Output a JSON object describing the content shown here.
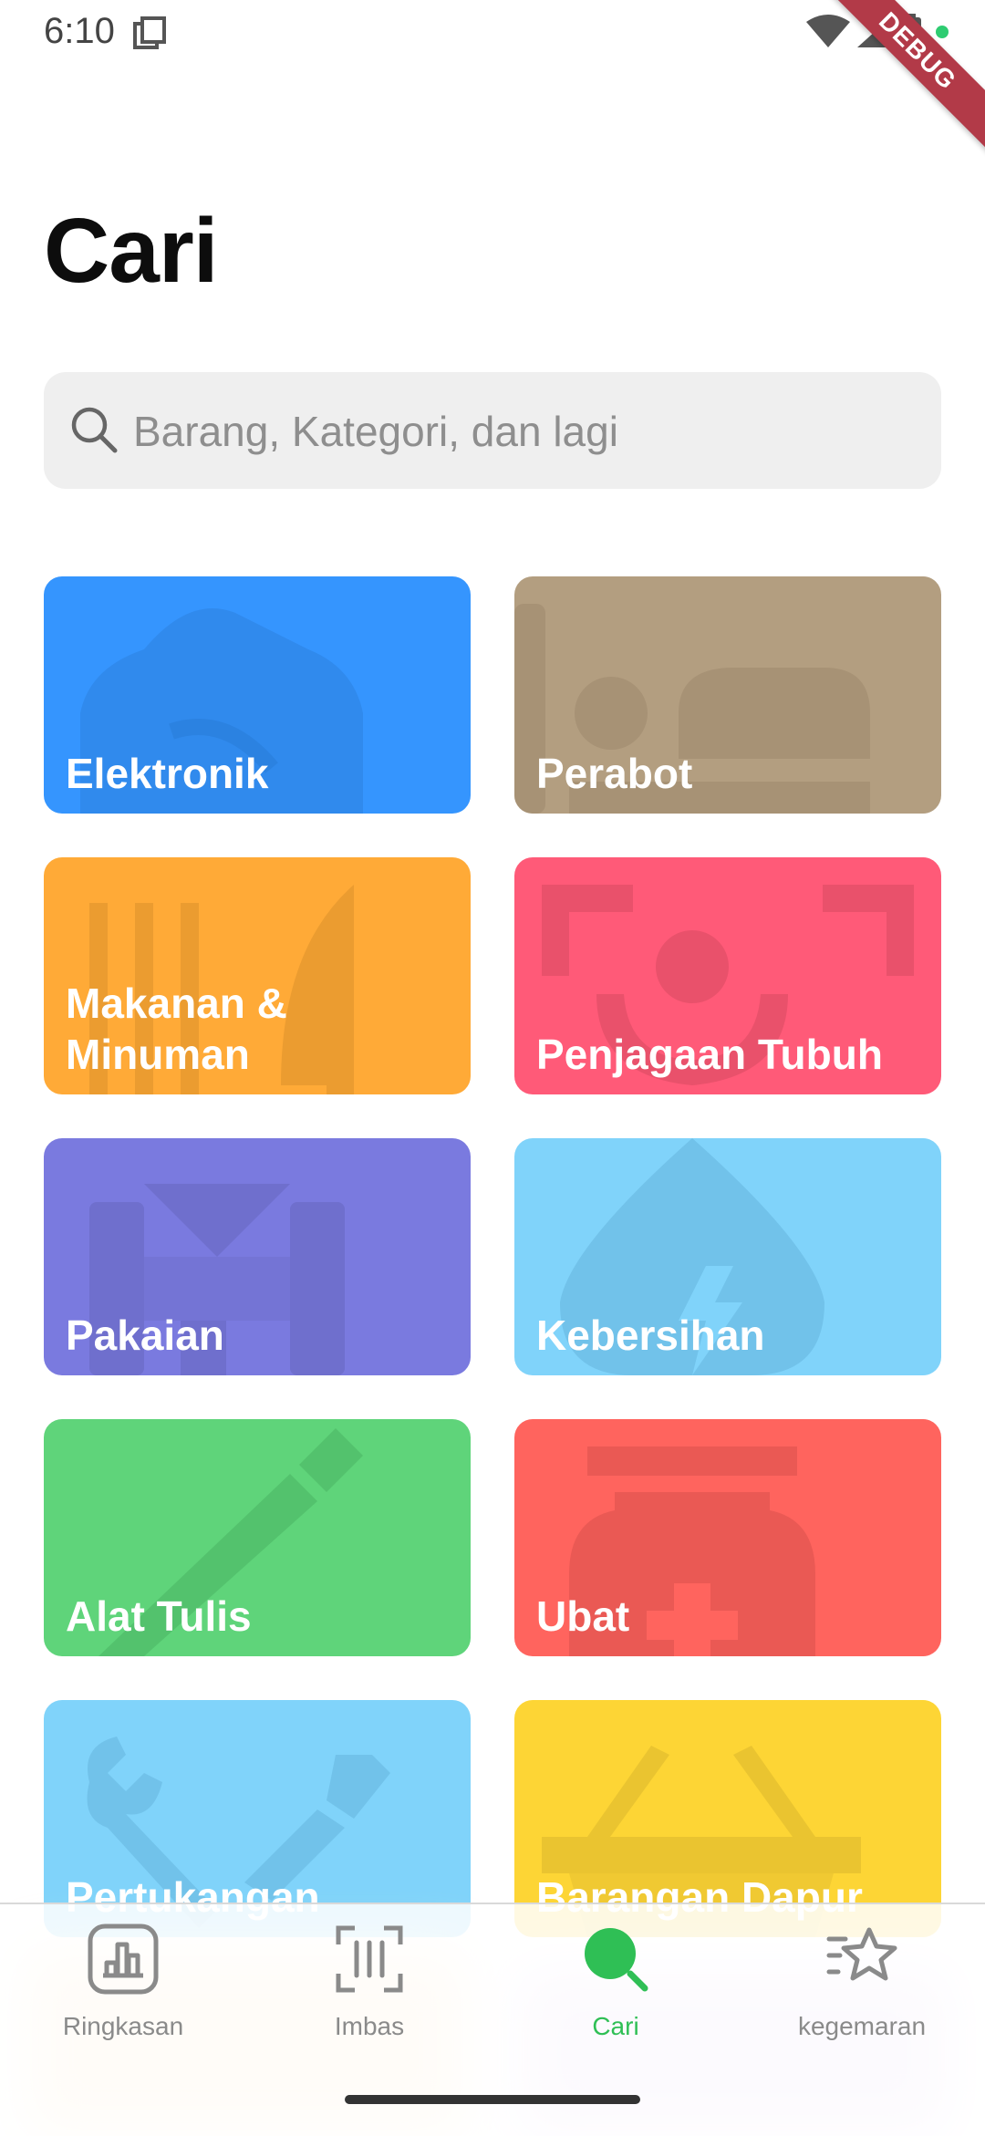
{
  "status_bar": {
    "time": "6:10",
    "debug_label": "DEBUG"
  },
  "page": {
    "title": "Cari"
  },
  "search": {
    "placeholder": "Barang, Kategori, dan lagi"
  },
  "categories": [
    {
      "label": "Elektronik",
      "color": "#3595FE",
      "icon": "router-icon"
    },
    {
      "label": "Perabot",
      "color": "#B39E80",
      "icon": "bed-icon"
    },
    {
      "label": "Makanan & Minuman",
      "color": "#FFAA37",
      "icon": "utensils-icon"
    },
    {
      "label": "Penjagaan Tubuh",
      "color": "#FF5A78",
      "icon": "face-scan-icon"
    },
    {
      "label": "Pakaian",
      "color": "#7A7ADF",
      "icon": "suit-icon"
    },
    {
      "label": "Kebersihan",
      "color": "#80D3FA",
      "icon": "water-drop-icon"
    },
    {
      "label": "Alat Tulis",
      "color": "#5FD47A",
      "icon": "pen-icon"
    },
    {
      "label": "Ubat",
      "color": "#FF645E",
      "icon": "medicine-bottle-icon"
    },
    {
      "label": "Pertukangan",
      "color": "#80D3FA",
      "icon": "tools-icon"
    },
    {
      "label": "Barangan Dapur",
      "color": "#FDD535",
      "icon": "basket-icon"
    }
  ],
  "bottom_nav": [
    {
      "label": "Ringkasan",
      "icon": "chart-icon",
      "active": false
    },
    {
      "label": "Imbas",
      "icon": "barcode-scan-icon",
      "active": false
    },
    {
      "label": "Cari",
      "icon": "search-icon",
      "active": true
    },
    {
      "label": "kegemaran",
      "icon": "favorite-list-icon",
      "active": false
    }
  ],
  "colors": {
    "active": "#2FBF55",
    "inactive": "#8A8A8A"
  }
}
